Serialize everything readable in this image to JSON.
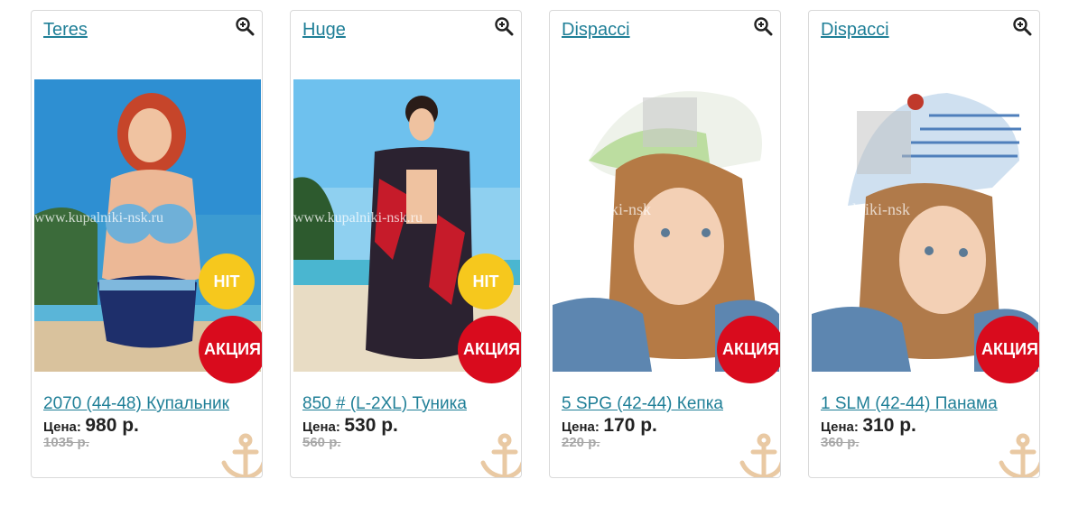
{
  "cards": [
    {
      "brand": "Teres",
      "title": "2070 (44-48) Купальник",
      "price_label": "Цена:",
      "price": "980 р.",
      "old_price": "1035 р.",
      "badges": [
        "HIT",
        "АКЦИЯ"
      ],
      "watermark": "www.kupalniki-nsk.ru",
      "photo_icon": "woman-swimsuit-photo"
    },
    {
      "brand": "Huge",
      "title": "850 # (L-2XL) Туника",
      "price_label": "Цена:",
      "price": "530 р.",
      "old_price": "560 р.",
      "badges": [
        "HIT",
        "АКЦИЯ"
      ],
      "watermark": "www.kupalniki-nsk.ru",
      "photo_icon": "woman-tunic-photo"
    },
    {
      "brand": "Dispacci",
      "title": "5 SPG (42-44) Кепка",
      "price_label": "Цена:",
      "price": "170 р.",
      "old_price": "220 р.",
      "badges": [
        "АКЦИЯ"
      ],
      "watermark": "kupalniki-nsk",
      "photo_icon": "girl-cap-photo"
    },
    {
      "brand": "Dispacci",
      "title": "1 SLM (42-44) Панама",
      "price_label": "Цена:",
      "price": "310 р.",
      "old_price": "360 р.",
      "badges": [
        "АКЦИЯ"
      ],
      "watermark": "kupalniki-nsk",
      "photo_icon": "girl-panama-photo"
    }
  ],
  "colors": {
    "link": "#1f7f97",
    "hit_badge": "#f6c81d",
    "sale_badge": "#d90b1d",
    "old_price": "#a8a8a8",
    "anchor": "#e9c9a3"
  }
}
